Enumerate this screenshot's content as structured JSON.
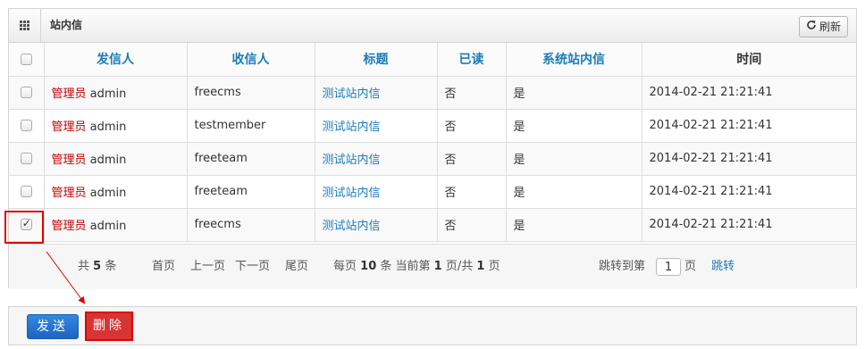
{
  "panel": {
    "title": "站内信",
    "refresh_label": "刷新"
  },
  "table": {
    "headers": [
      "发信人",
      "收信人",
      "标题",
      "已读",
      "系统站内信",
      "时间"
    ],
    "rows": [
      {
        "checked": false,
        "sender_role": "管理员",
        "sender_name": "admin",
        "recipient": "freecms",
        "title": "测试站内信",
        "read": "否",
        "system": "是",
        "time": "2014-02-21 21:21:41"
      },
      {
        "checked": false,
        "sender_role": "管理员",
        "sender_name": "admin",
        "recipient": "testmember",
        "title": "测试站内信",
        "read": "否",
        "system": "是",
        "time": "2014-02-21 21:21:41"
      },
      {
        "checked": false,
        "sender_role": "管理员",
        "sender_name": "admin",
        "recipient": "freeteam",
        "title": "测试站内信",
        "read": "否",
        "system": "是",
        "time": "2014-02-21 21:21:41"
      },
      {
        "checked": false,
        "sender_role": "管理员",
        "sender_name": "admin",
        "recipient": "freeteam",
        "title": "测试站内信",
        "read": "否",
        "system": "是",
        "time": "2014-02-21 21:21:41"
      },
      {
        "checked": true,
        "sender_role": "管理员",
        "sender_name": "admin",
        "recipient": "freecms",
        "title": "测试站内信",
        "read": "否",
        "system": "是",
        "time": "2014-02-21 21:21:41"
      }
    ]
  },
  "pager": {
    "total_prefix": "共",
    "total": "5",
    "total_suffix": "条",
    "first": "首页",
    "prev": "上一页",
    "next": "下一页",
    "last": "尾页",
    "per_page_prefix": "每页",
    "per_page": "10",
    "per_page_suffix": "条 当前第",
    "current": "1",
    "of": "页/共",
    "pages": "1",
    "pages_suffix": "页",
    "jump_label": "跳转到第",
    "jump_value": "1",
    "jump_suffix": "页",
    "jump_button": "跳转"
  },
  "actions": {
    "send": "发送",
    "delete": "删除"
  },
  "colors": {
    "link": "#1a7bb9",
    "sender": "#c00000",
    "highlight": "#e00000",
    "send_button": "#2a7fd8"
  }
}
